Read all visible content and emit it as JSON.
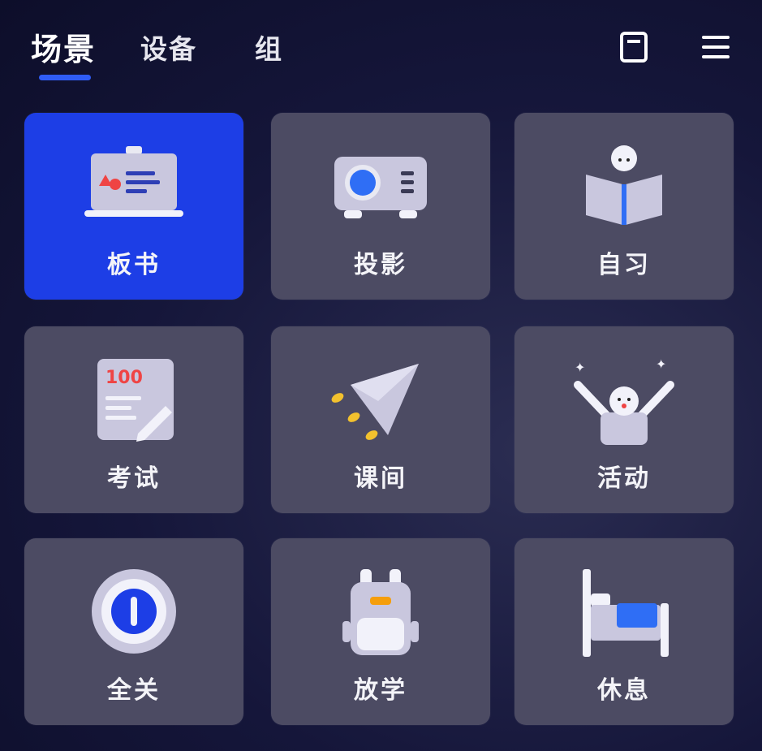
{
  "tabs": [
    {
      "label": "场景",
      "active": true
    },
    {
      "label": "设备",
      "active": false
    },
    {
      "label": "组",
      "active": false
    }
  ],
  "header_icons": [
    "document-icon",
    "menu-icon"
  ],
  "colors": {
    "accent": "#2f5cf5",
    "active_tile": "#1d3ee6",
    "tile": "#4c4b63"
  },
  "scenes": [
    {
      "label": "板书",
      "icon": "blackboard-icon",
      "active": true
    },
    {
      "label": "投影",
      "icon": "projector-icon",
      "active": false
    },
    {
      "label": "自习",
      "icon": "self-study-icon",
      "active": false
    },
    {
      "label": "考试",
      "icon": "exam-paper-icon",
      "active": false
    },
    {
      "label": "课间",
      "icon": "paper-plane-icon",
      "active": false
    },
    {
      "label": "活动",
      "icon": "activity-cheer-icon",
      "active": false
    },
    {
      "label": "全关",
      "icon": "power-off-icon",
      "active": false
    },
    {
      "label": "放学",
      "icon": "backpack-icon",
      "active": false
    },
    {
      "label": "休息",
      "icon": "bed-icon",
      "active": false
    }
  ]
}
